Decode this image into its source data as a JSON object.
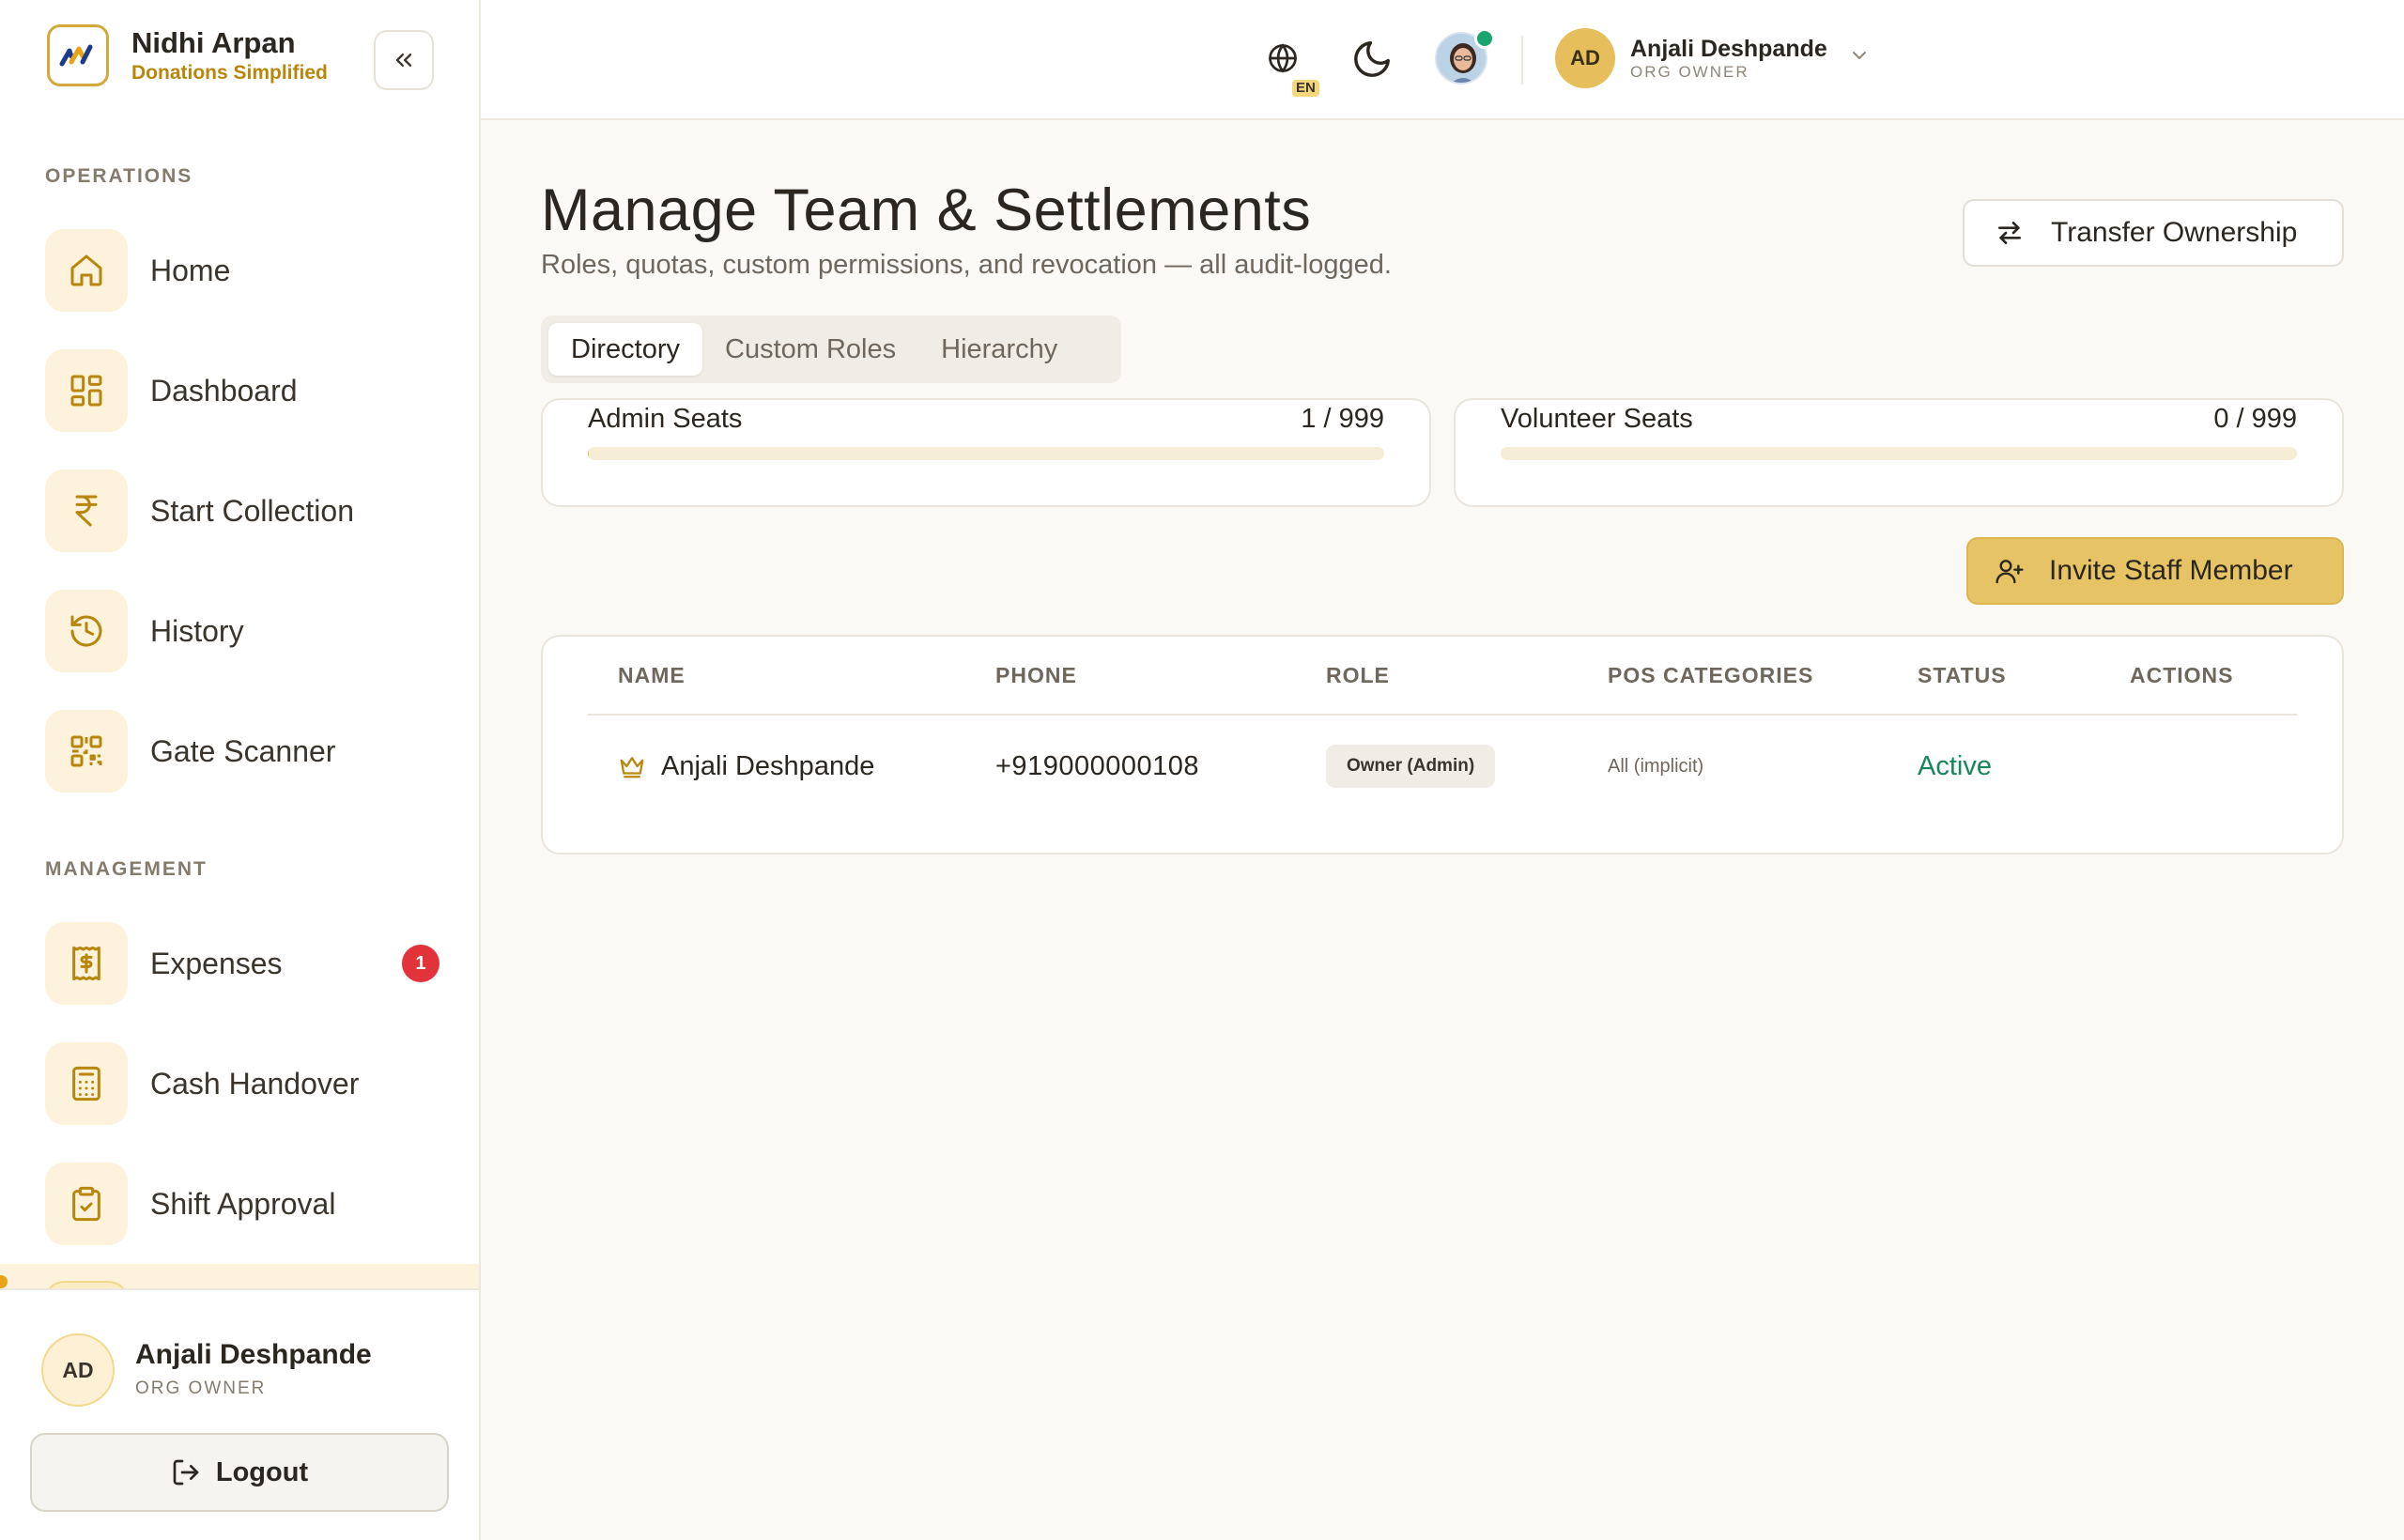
{
  "brand": {
    "name": "Nidhi Arpan",
    "tagline": "Donations Simplified"
  },
  "sidebar": {
    "sections": {
      "operations": "OPERATIONS",
      "management": "MANAGEMENT"
    },
    "operations_items": [
      {
        "label": "Home",
        "icon": "home-icon"
      },
      {
        "label": "Dashboard",
        "icon": "dashboard-icon"
      },
      {
        "label": "Start Collection",
        "icon": "rupee-icon"
      },
      {
        "label": "History",
        "icon": "history-icon"
      },
      {
        "label": "Gate Scanner",
        "icon": "qr-scanner-icon"
      }
    ],
    "management_items": [
      {
        "label": "Expenses",
        "icon": "receipt-dollar-icon",
        "badge": "1"
      },
      {
        "label": "Cash Handover",
        "icon": "calculator-icon"
      },
      {
        "label": "Shift Approval",
        "icon": "clipboard-check-icon"
      }
    ],
    "footer": {
      "initials": "AD",
      "name": "Anjali Deshpande",
      "role": "ORG OWNER",
      "logout_label": "Logout"
    }
  },
  "topbar": {
    "language": "EN",
    "user": {
      "initials": "AD",
      "name": "Anjali Deshpande",
      "role": "ORG OWNER"
    }
  },
  "main": {
    "title": "Manage Team & Settlements",
    "subtitle": "Roles, quotas, custom permissions, and revocation — all audit-logged.",
    "transfer_label": "Transfer Ownership",
    "tabs": [
      {
        "label": "Directory",
        "active": true
      },
      {
        "label": "Custom Roles",
        "active": false
      },
      {
        "label": "Hierarchy",
        "active": false
      }
    ],
    "seats": {
      "admin": {
        "label": "Admin Seats",
        "count": "1 / 999",
        "used": 1,
        "total": 999
      },
      "volunteer": {
        "label": "Volunteer Seats",
        "count": "0 / 999",
        "used": 0,
        "total": 999
      }
    },
    "invite_label": "Invite Staff Member",
    "table": {
      "columns": [
        "NAME",
        "PHONE",
        "ROLE",
        "POS CATEGORIES",
        "STATUS",
        "ACTIONS"
      ],
      "rows": [
        {
          "name": "Anjali Deshpande",
          "phone": "+919000000108",
          "role": "Owner (Admin)",
          "pos": "All (implicit)",
          "status": "Active"
        }
      ]
    }
  },
  "colors": {
    "accent": "#e6c365",
    "icon_gold": "#b8860b",
    "status_active": "#17875a",
    "badge_red": "#e2323a"
  }
}
